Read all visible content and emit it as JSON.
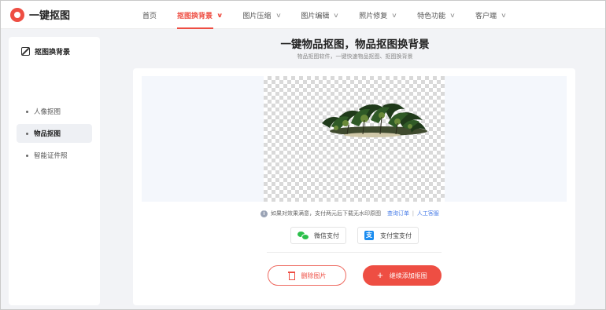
{
  "app": {
    "name": "一键抠图"
  },
  "nav": [
    {
      "label": "首页",
      "has_dropdown": false,
      "active": false
    },
    {
      "label": "抠图换背景",
      "has_dropdown": true,
      "active": true
    },
    {
      "label": "图片压缩",
      "has_dropdown": true,
      "active": false
    },
    {
      "label": "图片编辑",
      "has_dropdown": true,
      "active": false
    },
    {
      "label": "照片修复",
      "has_dropdown": true,
      "active": false
    },
    {
      "label": "特色功能",
      "has_dropdown": true,
      "active": false
    },
    {
      "label": "客户端",
      "has_dropdown": true,
      "active": false
    }
  ],
  "sidebar": {
    "title": "抠图换背景",
    "items": [
      {
        "label": "人像抠图",
        "active": false
      },
      {
        "label": "物品抠图",
        "active": true
      },
      {
        "label": "智能证件照",
        "active": false
      }
    ]
  },
  "main": {
    "title": "一键物品抠图，物品抠图换背景",
    "subtitle": "物品抠图软件，一键快速物品抠图、抠图换背景",
    "notice": {
      "text": "如果对效果满意，支付两元后下载无水印原图",
      "link_orders": "查询订单",
      "separator": "|",
      "link_service": "人工客服"
    },
    "payment": {
      "wechat_label": "微信支付",
      "alipay_label": "支付宝支付",
      "alipay_glyph": "支"
    },
    "delete_label": "删除图片",
    "add_label": "继续添加抠图"
  },
  "colors": {
    "accent": "#ee4e43",
    "link": "#4a7ee8",
    "wechat": "#2bbf4a",
    "alipay": "#1a8cf0"
  }
}
